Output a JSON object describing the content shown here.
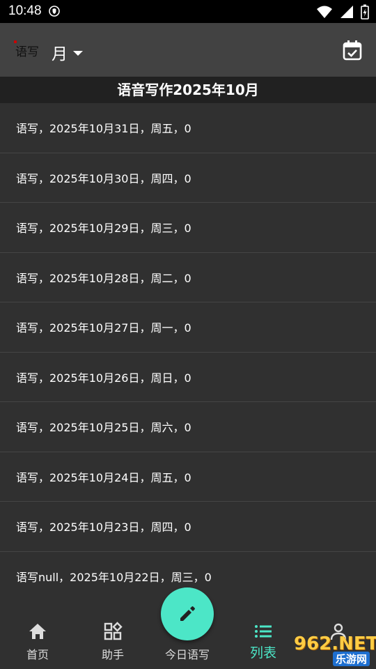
{
  "status": {
    "time": "10:48"
  },
  "appbar": {
    "logo_text": "语写",
    "mode": "月"
  },
  "header": {
    "title": "语音写作2025年10月"
  },
  "entries": [
    "语写，2025年10月31日，周五，0",
    "语写，2025年10月30日，周四，0",
    "语写，2025年10月29日，周三，0",
    "语写，2025年10月28日，周二，0",
    "语写，2025年10月27日，周一，0",
    "语写，2025年10月26日，周日，0",
    "语写，2025年10月25日，周六，0",
    "语写，2025年10月24日，周五，0",
    "语写，2025年10月23日，周四，0",
    "语写null，2025年10月22日，周三，0"
  ],
  "nav": {
    "items": [
      {
        "label": "首页",
        "icon": "home-icon"
      },
      {
        "label": "助手",
        "icon": "widgets-icon"
      },
      {
        "label": "今日语写",
        "icon": "none"
      },
      {
        "label": "列表",
        "icon": "list-icon"
      },
      {
        "label": "",
        "icon": "person-icon"
      }
    ],
    "active_index": 3,
    "active_color": "#4ce6c7"
  },
  "fab": {
    "icon": "edit-pencil-icon",
    "color": "#4ce6c7"
  },
  "watermark": {
    "text": "962.NET",
    "sub": "乐游网"
  }
}
